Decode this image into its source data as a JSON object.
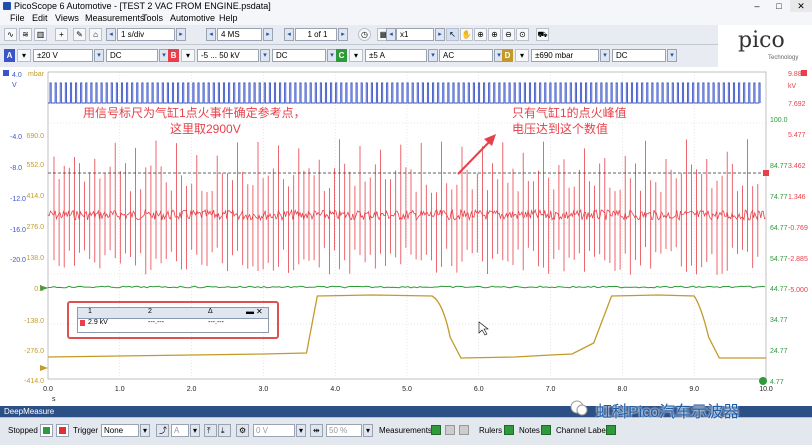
{
  "window": {
    "title": "PicoScope 6 Automotive - [TEST 2 VAC FROM ENGINE.psdata]",
    "min": "–",
    "max": "□",
    "close": "✕"
  },
  "menu": [
    "File",
    "Edit",
    "Views",
    "Measurements",
    "Tools",
    "Automotive",
    "Help"
  ],
  "toolbar": {
    "timebase": "1 s/div",
    "samples": "4 MS",
    "buffer": "1 of 1",
    "zoom": "x1"
  },
  "channels": [
    {
      "id": "A",
      "range": "±20 V",
      "coupling": "DC",
      "color": "#3a55c9"
    },
    {
      "id": "B",
      "range": "-5 ... 50 kV",
      "coupling": "DC",
      "color": "#e8404a"
    },
    {
      "id": "C",
      "range": "±5 A",
      "coupling": "AC",
      "color": "#2e9a3a"
    },
    {
      "id": "D",
      "range": "±690 mbar",
      "coupling": "DC",
      "color": "#c39a2a"
    }
  ],
  "logo": {
    "brand": "pico",
    "tagline": "Technology"
  },
  "axes": {
    "left_blue": [
      "4.0",
      "V"
    ],
    "left_orange": [
      "mbar",
      "690.0",
      "552.0",
      "414.0",
      "276.0",
      "138.0",
      "0.0",
      "-138.0",
      "-276.0",
      "-414.0"
    ],
    "left_red": [
      "-4.0",
      "-8.0",
      "-12.0",
      "-16.0",
      "-20.0"
    ],
    "right_green": [
      "100.0",
      "84.77",
      "74.77",
      "64.77",
      "54.77",
      "44.77",
      "34.77",
      "24.77",
      "4.77"
    ],
    "right_red": [
      "9.889",
      "kV",
      "7.692",
      "5.477",
      "3.462",
      "1.346",
      "-0.769",
      "-2.885",
      "-5.000"
    ],
    "x_ticks": [
      "0.0",
      "1.0",
      "2.0",
      "3.0",
      "4.0",
      "5.0",
      "6.0",
      "7.0",
      "8.0",
      "9.0",
      "10.0"
    ],
    "x_unit": "s"
  },
  "annotations": {
    "left_line1": "用信号标尺为气缸1点火事件确定参考点，",
    "left_line2": "这里取2900V",
    "right_line1": "只有气缸1的点火峰值",
    "right_line2": "电压达到这个数值"
  },
  "ruler_table": {
    "headers": [
      "1",
      "2",
      "Δ"
    ],
    "row": {
      "ch1": "2.9 kV",
      "ch2": "---.---",
      "delta": "---.---"
    }
  },
  "deepmeasure": "DeepMeasure",
  "bottom": {
    "stopped": "Stopped",
    "trigger_label": "Trigger",
    "trigger_mode": "None",
    "trigger_channel": "A",
    "trigger_level": "0 V",
    "trigger_percent": "50 %",
    "measurements": "Measurements",
    "rulers": "Rulers",
    "notes": "Notes",
    "channel_labels": "Channel Labels"
  },
  "watermark": "虹科Pico汽车示波器"
}
